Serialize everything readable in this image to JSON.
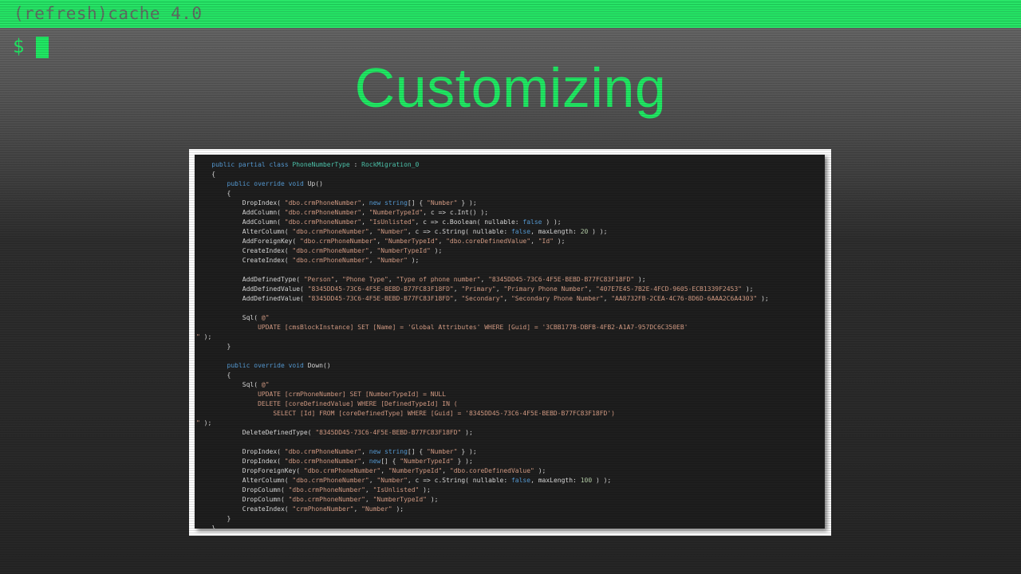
{
  "window": {
    "title": "(refresh)cache 4.0"
  },
  "terminal": {
    "prompt": "$"
  },
  "slide": {
    "title": "Customizing"
  },
  "code_lines": [
    [
      [
        "pl",
        "    "
      ],
      [
        "kw",
        "public partial class "
      ],
      [
        "ty",
        "PhoneNumberType"
      ],
      [
        "pl",
        " : "
      ],
      [
        "ty",
        "RockMigration_0"
      ]
    ],
    [
      [
        "pl",
        "    {"
      ]
    ],
    [
      [
        "pl",
        "        "
      ],
      [
        "kw",
        "public override void "
      ],
      [
        "pl",
        "Up()"
      ]
    ],
    [
      [
        "pl",
        "        {"
      ]
    ],
    [
      [
        "pl",
        "            DropIndex( "
      ],
      [
        "st",
        "\"dbo.crmPhoneNumber\""
      ],
      [
        "pl",
        ", "
      ],
      [
        "kw",
        "new string"
      ],
      [
        "pl",
        "[] { "
      ],
      [
        "st",
        "\"Number\""
      ],
      [
        "pl",
        " } );"
      ]
    ],
    [
      [
        "pl",
        "            AddColumn( "
      ],
      [
        "st",
        "\"dbo.crmPhoneNumber\""
      ],
      [
        "pl",
        ", "
      ],
      [
        "st",
        "\"NumberTypeId\""
      ],
      [
        "pl",
        ", c => c.Int() );"
      ]
    ],
    [
      [
        "pl",
        "            AddColumn( "
      ],
      [
        "st",
        "\"dbo.crmPhoneNumber\""
      ],
      [
        "pl",
        ", "
      ],
      [
        "st",
        "\"IsUnlisted\""
      ],
      [
        "pl",
        ", c => c.Boolean( nullable: "
      ],
      [
        "kw",
        "false"
      ],
      [
        "pl",
        " ) );"
      ]
    ],
    [
      [
        "pl",
        "            AlterColumn( "
      ],
      [
        "st",
        "\"dbo.crmPhoneNumber\""
      ],
      [
        "pl",
        ", "
      ],
      [
        "st",
        "\"Number\""
      ],
      [
        "pl",
        ", c => c.String( nullable: "
      ],
      [
        "kw",
        "false"
      ],
      [
        "pl",
        ", maxLength: "
      ],
      [
        "nu",
        "20"
      ],
      [
        "pl",
        " ) );"
      ]
    ],
    [
      [
        "pl",
        "            AddForeignKey( "
      ],
      [
        "st",
        "\"dbo.crmPhoneNumber\""
      ],
      [
        "pl",
        ", "
      ],
      [
        "st",
        "\"NumberTypeId\""
      ],
      [
        "pl",
        ", "
      ],
      [
        "st",
        "\"dbo.coreDefinedValue\""
      ],
      [
        "pl",
        ", "
      ],
      [
        "st",
        "\"Id\""
      ],
      [
        "pl",
        " );"
      ]
    ],
    [
      [
        "pl",
        "            CreateIndex( "
      ],
      [
        "st",
        "\"dbo.crmPhoneNumber\""
      ],
      [
        "pl",
        ", "
      ],
      [
        "st",
        "\"NumberTypeId\""
      ],
      [
        "pl",
        " );"
      ]
    ],
    [
      [
        "pl",
        "            CreateIndex( "
      ],
      [
        "st",
        "\"dbo.crmPhoneNumber\""
      ],
      [
        "pl",
        ", "
      ],
      [
        "st",
        "\"Number\""
      ],
      [
        "pl",
        " );"
      ]
    ],
    [
      [
        "pl",
        ""
      ]
    ],
    [
      [
        "pl",
        "            AddDefinedType( "
      ],
      [
        "st",
        "\"Person\""
      ],
      [
        "pl",
        ", "
      ],
      [
        "st",
        "\"Phone Type\""
      ],
      [
        "pl",
        ", "
      ],
      [
        "st",
        "\"Type of phone number\""
      ],
      [
        "pl",
        ", "
      ],
      [
        "st",
        "\"8345DD45-73C6-4F5E-BEBD-B77FC83F18FD\""
      ],
      [
        "pl",
        " );"
      ]
    ],
    [
      [
        "pl",
        "            AddDefinedValue( "
      ],
      [
        "st",
        "\"8345DD45-73C6-4F5E-BEBD-B77FC83F18FD\""
      ],
      [
        "pl",
        ", "
      ],
      [
        "st",
        "\"Primary\""
      ],
      [
        "pl",
        ", "
      ],
      [
        "st",
        "\"Primary Phone Number\""
      ],
      [
        "pl",
        ", "
      ],
      [
        "st",
        "\"407E7E45-7B2E-4FCD-9605-ECB1339F2453\""
      ],
      [
        "pl",
        " );"
      ]
    ],
    [
      [
        "pl",
        "            AddDefinedValue( "
      ],
      [
        "st",
        "\"8345DD45-73C6-4F5E-BEBD-B77FC83F18FD\""
      ],
      [
        "pl",
        ", "
      ],
      [
        "st",
        "\"Secondary\""
      ],
      [
        "pl",
        ", "
      ],
      [
        "st",
        "\"Secondary Phone Number\""
      ],
      [
        "pl",
        ", "
      ],
      [
        "st",
        "\"AA8732FB-2CEA-4C76-8D6D-6AAA2C6A4303\""
      ],
      [
        "pl",
        " );"
      ]
    ],
    [
      [
        "pl",
        ""
      ]
    ],
    [
      [
        "pl",
        "            Sql( "
      ],
      [
        "st",
        "@\""
      ]
    ],
    [
      [
        "st",
        "                UPDATE [cmsBlockInstance] SET [Name] = 'Global Attributes' WHERE [Guid] = '3CBB177B-DBFB-4FB2-A1A7-957DC6C350EB'"
      ]
    ],
    [
      [
        "st",
        "\""
      ],
      [
        "pl",
        " );"
      ]
    ],
    [
      [
        "pl",
        "        }"
      ]
    ],
    [
      [
        "pl",
        ""
      ]
    ],
    [
      [
        "pl",
        "        "
      ],
      [
        "kw",
        "public override void "
      ],
      [
        "pl",
        "Down()"
      ]
    ],
    [
      [
        "pl",
        "        {"
      ]
    ],
    [
      [
        "pl",
        "            Sql( "
      ],
      [
        "st",
        "@\""
      ]
    ],
    [
      [
        "st",
        "                UPDATE [crmPhoneNumber] SET [NumberTypeId] = NULL"
      ]
    ],
    [
      [
        "st",
        "                DELETE [coreDefinedValue] WHERE [DefinedTypeId] IN ("
      ]
    ],
    [
      [
        "st",
        "                    SELECT [Id] FROM [coreDefinedType] WHERE [Guid] = '8345DD45-73C6-4F5E-BEBD-B77FC83F18FD')"
      ]
    ],
    [
      [
        "st",
        "\""
      ],
      [
        "pl",
        " );"
      ]
    ],
    [
      [
        "pl",
        "            DeleteDefinedType( "
      ],
      [
        "st",
        "\"8345DD45-73C6-4F5E-BEBD-B77FC83F18FD\""
      ],
      [
        "pl",
        " );"
      ]
    ],
    [
      [
        "pl",
        ""
      ]
    ],
    [
      [
        "pl",
        "            DropIndex( "
      ],
      [
        "st",
        "\"dbo.crmPhoneNumber\""
      ],
      [
        "pl",
        ", "
      ],
      [
        "kw",
        "new string"
      ],
      [
        "pl",
        "[] { "
      ],
      [
        "st",
        "\"Number\""
      ],
      [
        "pl",
        " } );"
      ]
    ],
    [
      [
        "pl",
        "            DropIndex( "
      ],
      [
        "st",
        "\"dbo.crmPhoneNumber\""
      ],
      [
        "pl",
        ", "
      ],
      [
        "kw",
        "new"
      ],
      [
        "pl",
        "[] { "
      ],
      [
        "st",
        "\"NumberTypeId\""
      ],
      [
        "pl",
        " } );"
      ]
    ],
    [
      [
        "pl",
        "            DropForeignKey( "
      ],
      [
        "st",
        "\"dbo.crmPhoneNumber\""
      ],
      [
        "pl",
        ", "
      ],
      [
        "st",
        "\"NumberTypeId\""
      ],
      [
        "pl",
        ", "
      ],
      [
        "st",
        "\"dbo.coreDefinedValue\""
      ],
      [
        "pl",
        " );"
      ]
    ],
    [
      [
        "pl",
        "            AlterColumn( "
      ],
      [
        "st",
        "\"dbo.crmPhoneNumber\""
      ],
      [
        "pl",
        ", "
      ],
      [
        "st",
        "\"Number\""
      ],
      [
        "pl",
        ", c => c.String( nullable: "
      ],
      [
        "kw",
        "false"
      ],
      [
        "pl",
        ", maxLength: "
      ],
      [
        "nu",
        "100"
      ],
      [
        "pl",
        " ) );"
      ]
    ],
    [
      [
        "pl",
        "            DropColumn( "
      ],
      [
        "st",
        "\"dbo.crmPhoneNumber\""
      ],
      [
        "pl",
        ", "
      ],
      [
        "st",
        "\"IsUnlisted\""
      ],
      [
        "pl",
        " );"
      ]
    ],
    [
      [
        "pl",
        "            DropColumn( "
      ],
      [
        "st",
        "\"dbo.crmPhoneNumber\""
      ],
      [
        "pl",
        ", "
      ],
      [
        "st",
        "\"NumberTypeId\""
      ],
      [
        "pl",
        " );"
      ]
    ],
    [
      [
        "pl",
        "            CreateIndex( "
      ],
      [
        "st",
        "\"crmPhoneNumber\""
      ],
      [
        "pl",
        ", "
      ],
      [
        "st",
        "\"Number\""
      ],
      [
        "pl",
        " );"
      ]
    ],
    [
      [
        "pl",
        "        }"
      ]
    ],
    [
      [
        "pl",
        "    }"
      ]
    ]
  ]
}
